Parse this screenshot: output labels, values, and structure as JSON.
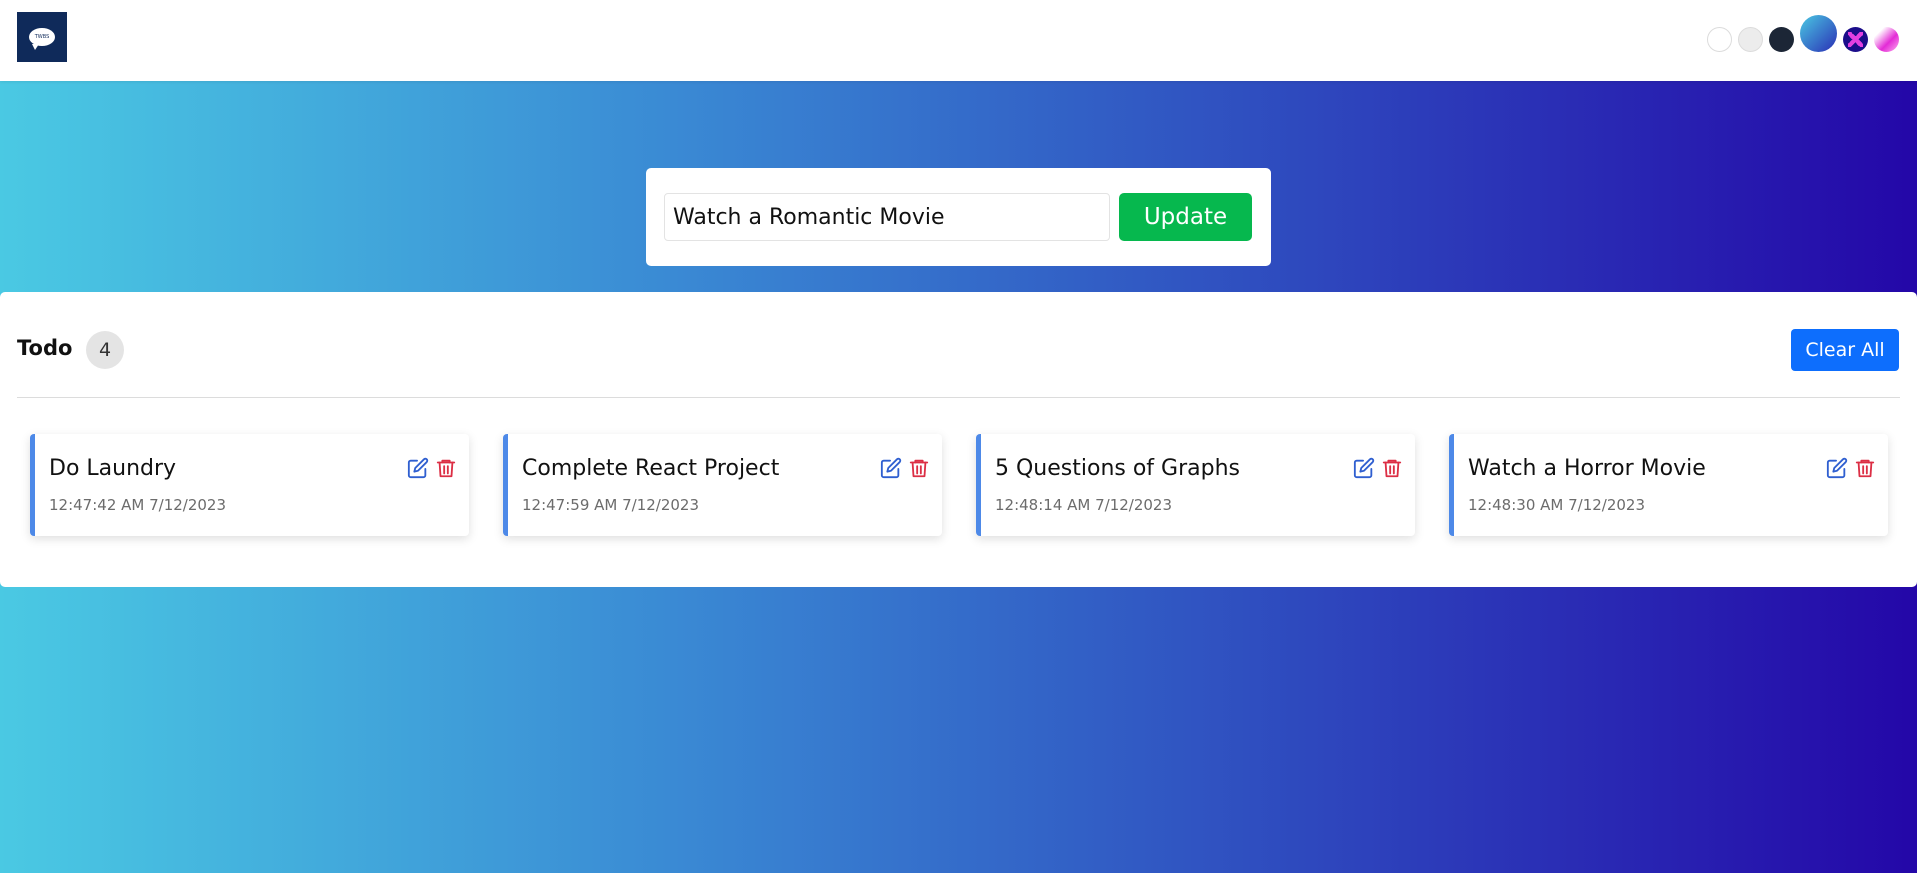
{
  "header": {
    "logo_text": "TWBS",
    "themes": [
      {
        "name": "white",
        "color": "#ffffff"
      },
      {
        "name": "light",
        "color": "#ececec"
      },
      {
        "name": "dark",
        "color": "#1c2636"
      },
      {
        "name": "blue-gradient",
        "color": "#3a8ad4"
      },
      {
        "name": "purple",
        "color": "#1b0d8a"
      },
      {
        "name": "pink",
        "color": "#e32bd6"
      }
    ]
  },
  "form": {
    "input_value": "Watch a Romantic Movie",
    "submit_label": "Update"
  },
  "todo_list": {
    "title": "Todo",
    "count": "4",
    "clear_label": "Clear All",
    "items": [
      {
        "title": "Do Laundry",
        "time": "12:47:42 AM 7/12/2023"
      },
      {
        "title": "Complete React Project",
        "time": "12:47:59 AM 7/12/2023"
      },
      {
        "title": "5 Questions of Graphs",
        "time": "12:48:14 AM 7/12/2023"
      },
      {
        "title": "Watch a Horror Movie",
        "time": "12:48:30 AM 7/12/2023"
      }
    ]
  },
  "colors": {
    "accent_blue": "#0d6efd",
    "update_green": "#06b84e",
    "card_border": "#4d89e8",
    "edit_icon": "#2f5fd0",
    "delete_icon": "#dc2f45"
  }
}
